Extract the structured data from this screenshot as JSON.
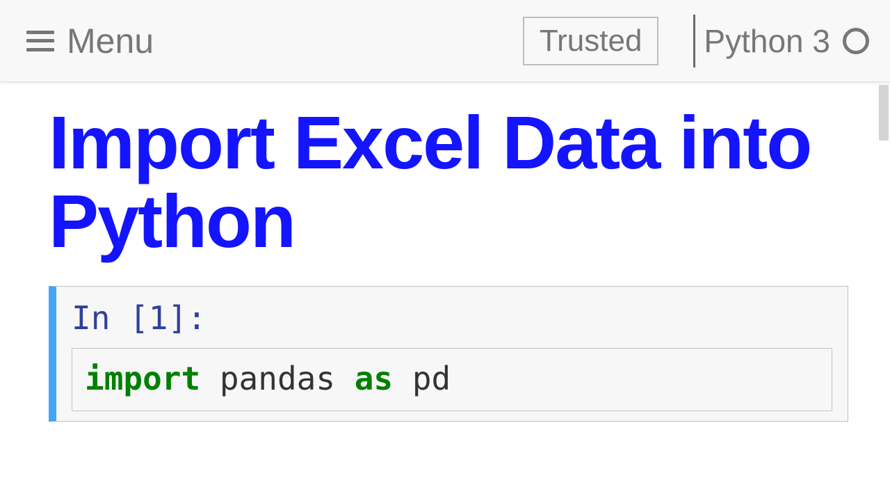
{
  "toolbar": {
    "menu_label": "Menu",
    "trusted_label": "Trusted",
    "kernel_label": "Python 3"
  },
  "heading": "Import Excel Data into Python",
  "cell": {
    "prompt": "In [1]:",
    "code": {
      "kw_import": "import",
      "module": " pandas ",
      "kw_as": "as",
      "alias": " pd"
    }
  }
}
